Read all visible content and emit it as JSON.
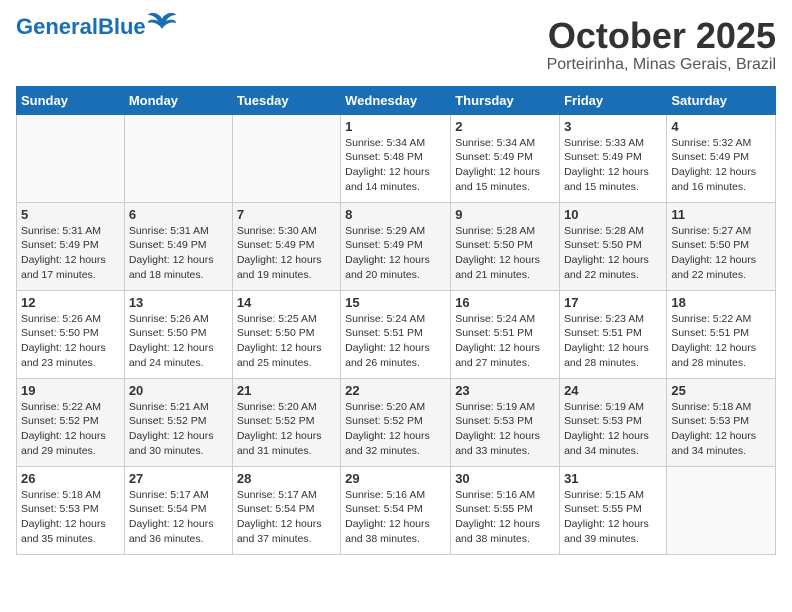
{
  "header": {
    "logo_general": "General",
    "logo_blue": "Blue",
    "month": "October 2025",
    "location": "Porteirinha, Minas Gerais, Brazil"
  },
  "days_of_week": [
    "Sunday",
    "Monday",
    "Tuesday",
    "Wednesday",
    "Thursday",
    "Friday",
    "Saturday"
  ],
  "weeks": [
    [
      {
        "day": "",
        "info": ""
      },
      {
        "day": "",
        "info": ""
      },
      {
        "day": "",
        "info": ""
      },
      {
        "day": "1",
        "info": "Sunrise: 5:34 AM\nSunset: 5:48 PM\nDaylight: 12 hours\nand 14 minutes."
      },
      {
        "day": "2",
        "info": "Sunrise: 5:34 AM\nSunset: 5:49 PM\nDaylight: 12 hours\nand 15 minutes."
      },
      {
        "day": "3",
        "info": "Sunrise: 5:33 AM\nSunset: 5:49 PM\nDaylight: 12 hours\nand 15 minutes."
      },
      {
        "day": "4",
        "info": "Sunrise: 5:32 AM\nSunset: 5:49 PM\nDaylight: 12 hours\nand 16 minutes."
      }
    ],
    [
      {
        "day": "5",
        "info": "Sunrise: 5:31 AM\nSunset: 5:49 PM\nDaylight: 12 hours\nand 17 minutes."
      },
      {
        "day": "6",
        "info": "Sunrise: 5:31 AM\nSunset: 5:49 PM\nDaylight: 12 hours\nand 18 minutes."
      },
      {
        "day": "7",
        "info": "Sunrise: 5:30 AM\nSunset: 5:49 PM\nDaylight: 12 hours\nand 19 minutes."
      },
      {
        "day": "8",
        "info": "Sunrise: 5:29 AM\nSunset: 5:49 PM\nDaylight: 12 hours\nand 20 minutes."
      },
      {
        "day": "9",
        "info": "Sunrise: 5:28 AM\nSunset: 5:50 PM\nDaylight: 12 hours\nand 21 minutes."
      },
      {
        "day": "10",
        "info": "Sunrise: 5:28 AM\nSunset: 5:50 PM\nDaylight: 12 hours\nand 22 minutes."
      },
      {
        "day": "11",
        "info": "Sunrise: 5:27 AM\nSunset: 5:50 PM\nDaylight: 12 hours\nand 22 minutes."
      }
    ],
    [
      {
        "day": "12",
        "info": "Sunrise: 5:26 AM\nSunset: 5:50 PM\nDaylight: 12 hours\nand 23 minutes."
      },
      {
        "day": "13",
        "info": "Sunrise: 5:26 AM\nSunset: 5:50 PM\nDaylight: 12 hours\nand 24 minutes."
      },
      {
        "day": "14",
        "info": "Sunrise: 5:25 AM\nSunset: 5:50 PM\nDaylight: 12 hours\nand 25 minutes."
      },
      {
        "day": "15",
        "info": "Sunrise: 5:24 AM\nSunset: 5:51 PM\nDaylight: 12 hours\nand 26 minutes."
      },
      {
        "day": "16",
        "info": "Sunrise: 5:24 AM\nSunset: 5:51 PM\nDaylight: 12 hours\nand 27 minutes."
      },
      {
        "day": "17",
        "info": "Sunrise: 5:23 AM\nSunset: 5:51 PM\nDaylight: 12 hours\nand 28 minutes."
      },
      {
        "day": "18",
        "info": "Sunrise: 5:22 AM\nSunset: 5:51 PM\nDaylight: 12 hours\nand 28 minutes."
      }
    ],
    [
      {
        "day": "19",
        "info": "Sunrise: 5:22 AM\nSunset: 5:52 PM\nDaylight: 12 hours\nand 29 minutes."
      },
      {
        "day": "20",
        "info": "Sunrise: 5:21 AM\nSunset: 5:52 PM\nDaylight: 12 hours\nand 30 minutes."
      },
      {
        "day": "21",
        "info": "Sunrise: 5:20 AM\nSunset: 5:52 PM\nDaylight: 12 hours\nand 31 minutes."
      },
      {
        "day": "22",
        "info": "Sunrise: 5:20 AM\nSunset: 5:52 PM\nDaylight: 12 hours\nand 32 minutes."
      },
      {
        "day": "23",
        "info": "Sunrise: 5:19 AM\nSunset: 5:53 PM\nDaylight: 12 hours\nand 33 minutes."
      },
      {
        "day": "24",
        "info": "Sunrise: 5:19 AM\nSunset: 5:53 PM\nDaylight: 12 hours\nand 34 minutes."
      },
      {
        "day": "25",
        "info": "Sunrise: 5:18 AM\nSunset: 5:53 PM\nDaylight: 12 hours\nand 34 minutes."
      }
    ],
    [
      {
        "day": "26",
        "info": "Sunrise: 5:18 AM\nSunset: 5:53 PM\nDaylight: 12 hours\nand 35 minutes."
      },
      {
        "day": "27",
        "info": "Sunrise: 5:17 AM\nSunset: 5:54 PM\nDaylight: 12 hours\nand 36 minutes."
      },
      {
        "day": "28",
        "info": "Sunrise: 5:17 AM\nSunset: 5:54 PM\nDaylight: 12 hours\nand 37 minutes."
      },
      {
        "day": "29",
        "info": "Sunrise: 5:16 AM\nSunset: 5:54 PM\nDaylight: 12 hours\nand 38 minutes."
      },
      {
        "day": "30",
        "info": "Sunrise: 5:16 AM\nSunset: 5:55 PM\nDaylight: 12 hours\nand 38 minutes."
      },
      {
        "day": "31",
        "info": "Sunrise: 5:15 AM\nSunset: 5:55 PM\nDaylight: 12 hours\nand 39 minutes."
      },
      {
        "day": "",
        "info": ""
      }
    ]
  ]
}
